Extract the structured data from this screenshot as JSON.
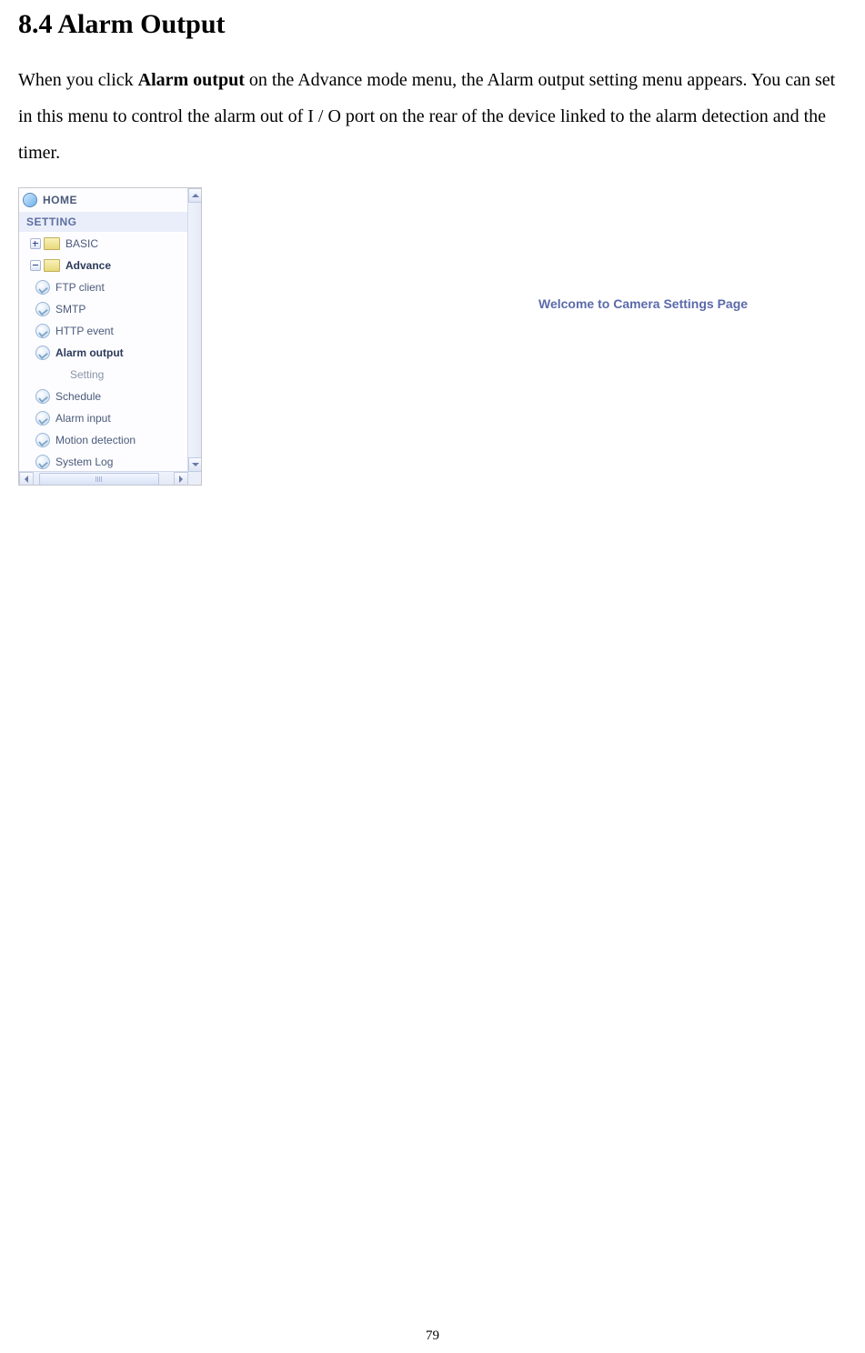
{
  "heading": "8.4 Alarm Output",
  "paragraph": {
    "pre": "When you click ",
    "bold": "Alarm output",
    "post": " on the Advance mode menu, the Alarm output setting menu appears. You can set in this menu to control the alarm out of I / O port on the rear of the device linked to the alarm detection and the timer."
  },
  "sidebar": {
    "home": "HOME",
    "section": "SETTING",
    "items": {
      "basic": "BASIC",
      "advance": "Advance",
      "ftp": "FTP client",
      "smtp": "SMTP",
      "http": "HTTP event",
      "alarm_output": "Alarm output",
      "setting": "Setting",
      "schedule": "Schedule",
      "alarm_input": "Alarm input",
      "motion": "Motion detection",
      "syslog": "System Log"
    }
  },
  "welcome": "Welcome to Camera Settings Page",
  "page_number": "79"
}
